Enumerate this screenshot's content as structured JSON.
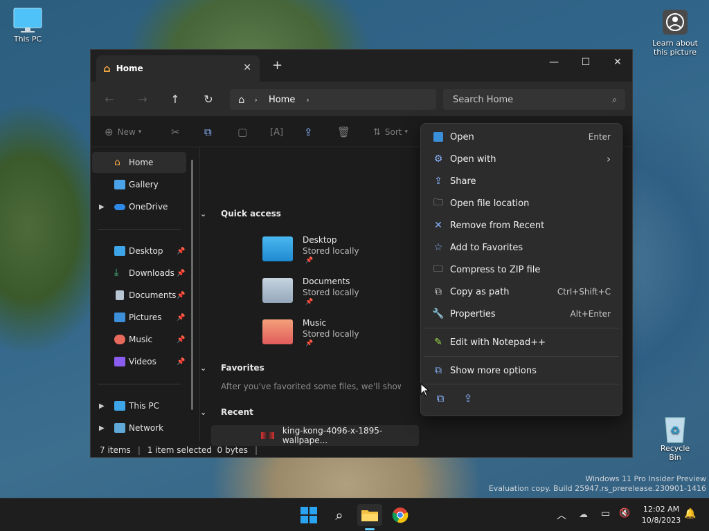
{
  "desktop": {
    "this_pc": "This PC",
    "learn_about": "Learn about this picture",
    "recycle_bin": "Recycle Bin",
    "watermark_line1": "Windows 11 Pro Insider Preview",
    "watermark_line2": "Evaluation copy. Build 25947.rs_prerelease.230901-1416"
  },
  "window": {
    "tab_title": "Home",
    "new_tab": "+",
    "minimize": "—",
    "maximize": "☐",
    "close": "✕",
    "breadcrumb": "Home",
    "search_placeholder": "Search Home"
  },
  "toolbar": {
    "new_label": "New",
    "sort_label": "Sort"
  },
  "sidebar": {
    "items": [
      {
        "label": "Home"
      },
      {
        "label": "Gallery"
      },
      {
        "label": "OneDrive"
      },
      {
        "label": "Desktop"
      },
      {
        "label": "Downloads"
      },
      {
        "label": "Documents"
      },
      {
        "label": "Pictures"
      },
      {
        "label": "Music"
      },
      {
        "label": "Videos"
      },
      {
        "label": "This PC"
      },
      {
        "label": "Network"
      }
    ]
  },
  "main": {
    "quick_access": "Quick access",
    "folders": [
      {
        "name": "Desktop",
        "status": "Stored locally"
      },
      {
        "name": "Documents",
        "status": "Stored locally"
      },
      {
        "name": "Music",
        "status": "Stored locally"
      }
    ],
    "favorites": "Favorites",
    "favorites_hint": "After you've favorited some files, we'll show them",
    "recent": "Recent",
    "recent_file": "king-kong-4096-x-1895-wallpape..."
  },
  "status": {
    "items": "7 items",
    "selected": "1 item selected  0 bytes"
  },
  "context_menu": {
    "items": [
      {
        "label": "Open",
        "shortcut": "Enter"
      },
      {
        "label": "Open with",
        "shortcut": "›"
      },
      {
        "label": "Share",
        "shortcut": ""
      },
      {
        "label": "Open file location",
        "shortcut": ""
      },
      {
        "label": "Remove from Recent",
        "shortcut": ""
      },
      {
        "label": "Add to Favorites",
        "shortcut": ""
      },
      {
        "label": "Compress to ZIP file",
        "shortcut": ""
      },
      {
        "label": "Copy as path",
        "shortcut": "Ctrl+Shift+C"
      },
      {
        "label": "Properties",
        "shortcut": "Alt+Enter"
      },
      {
        "label": "Edit with Notepad++",
        "shortcut": ""
      },
      {
        "label": "Show more options",
        "shortcut": ""
      }
    ]
  },
  "taskbar": {
    "time": "12:02 AM",
    "date": "10/8/2023"
  },
  "colors": {
    "accent": "#60cdff",
    "window_bg": "#1c1c1c",
    "menu_bg": "#2c2c2c"
  }
}
